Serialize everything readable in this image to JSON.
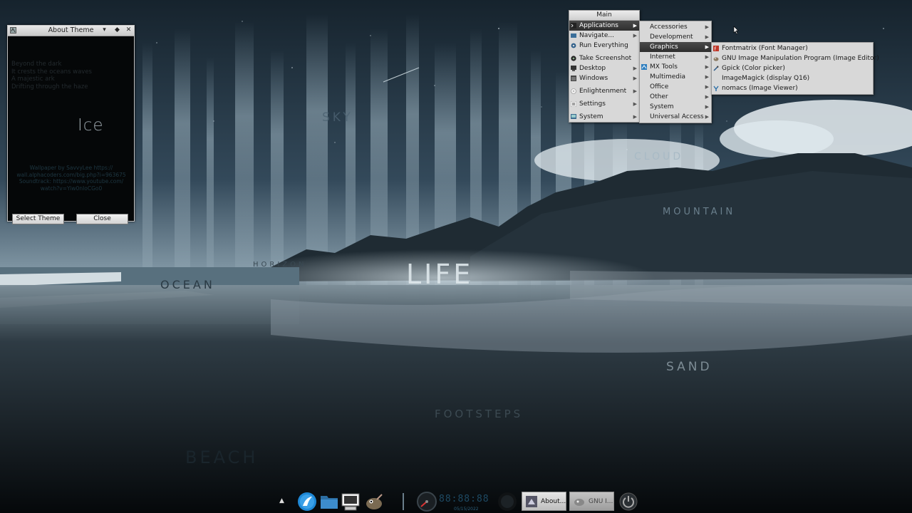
{
  "wallpaper": {
    "words": [
      "SKY",
      "CLOUD",
      "MOUNTAIN",
      "HORIZON",
      "OCEAN",
      "LIFE",
      "SAND",
      "FOOTSTEPS",
      "BEACH"
    ]
  },
  "about_window": {
    "title": "About Theme",
    "poem": [
      "Beyond the dark",
      "It crests the oceans waves",
      "A majestic ark",
      "Drifting through the haze"
    ],
    "logo_text": "Ice",
    "credits": [
      "Wallpaper by SavvyLee https://",
      "wall.alphacoders.com/big.php?i=963675",
      "Soundtrack: https://www.youtube.com/",
      "watch?v=Yiw0nIoCGo0"
    ],
    "buttons": {
      "select_theme": "Select Theme",
      "close": "Close"
    }
  },
  "main_menu": {
    "title": "Main",
    "items": [
      {
        "label": "Applications",
        "icon": "terminal-icon",
        "submenu": true,
        "active": true
      },
      {
        "label": "Navigate...",
        "icon": "folder-icon",
        "submenu": true
      },
      {
        "label": "Run Everything",
        "icon": "gear-icon",
        "submenu": false
      },
      {
        "label": "Take Screenshot",
        "icon": "camera-icon",
        "submenu": false
      },
      {
        "label": "Desktop",
        "icon": "desktop-icon",
        "submenu": true
      },
      {
        "label": "Windows",
        "icon": "windows-icon",
        "submenu": true
      },
      {
        "label": "Enlightenment",
        "icon": "enlightenment-icon",
        "submenu": true
      },
      {
        "label": "Settings",
        "icon": "settings-icon",
        "submenu": true
      },
      {
        "label": "System",
        "icon": "system-icon",
        "submenu": true
      }
    ]
  },
  "applications_menu": {
    "items": [
      "Accessories",
      "Development",
      "Graphics",
      "Internet",
      "MX Tools",
      "Multimedia",
      "Office",
      "Other",
      "System",
      "Universal Access"
    ],
    "active": "Graphics"
  },
  "graphics_menu": {
    "items": [
      {
        "label": "Fontmatrix (Font Manager)",
        "icon": "fontmatrix-icon"
      },
      {
        "label": "GNU Image Manipulation Program (Image Editor)",
        "icon": "gimp-icon"
      },
      {
        "label": "Gpick (Color picker)",
        "icon": "color-picker-icon"
      },
      {
        "label": "ImageMagick (display Q16)",
        "icon": "imagemagick-icon"
      },
      {
        "label": "nomacs (Image Viewer)",
        "icon": "nomacs-icon"
      }
    ]
  },
  "taskbar": {
    "clock": "88:88:88",
    "date": "05/15/2022",
    "tasks": [
      {
        "label": "About...",
        "icon": "theme-icon",
        "active": true
      },
      {
        "label": "GNU I...",
        "icon": "gimp-icon",
        "active": false
      }
    ]
  },
  "colors": {
    "menu_bg": "#d8d8d8",
    "menu_active": "#333333",
    "sky": "#1d2b36",
    "clock": "#1e4a64"
  }
}
